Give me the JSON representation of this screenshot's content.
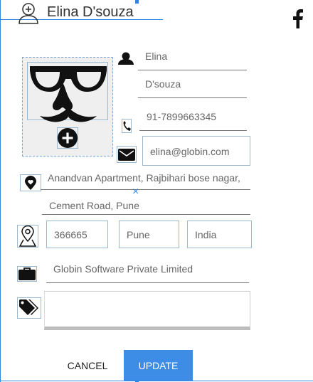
{
  "header": {
    "name": "Elina D'souza",
    "social_icon": "facebook-icon"
  },
  "form": {
    "first_name": "Elina",
    "last_name": "D'souza",
    "phone": "91-7899663345",
    "email": "elina@globin.com",
    "address_line1": "Anandvan Apartment, Rajbihari bose nagar,",
    "address_line2": "Cement Road, Pune",
    "zip": "366665",
    "city": "Pune",
    "country": "India",
    "company": "Globin Software Private Limited",
    "tags": ""
  },
  "actions": {
    "cancel": "CANCEL",
    "update": "UPDATE"
  },
  "colors": {
    "accent": "#3d8de6",
    "line": "#2f86e0"
  }
}
